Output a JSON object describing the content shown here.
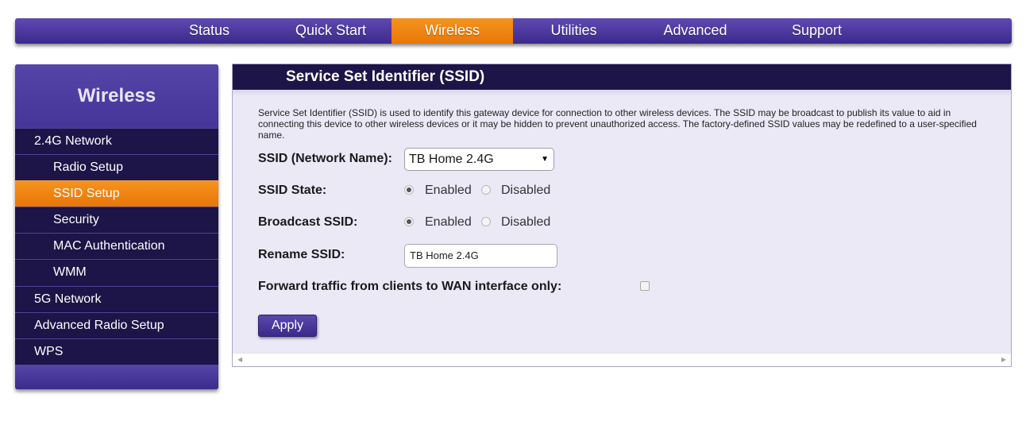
{
  "topnav": {
    "items": [
      {
        "label": "Status"
      },
      {
        "label": "Quick Start"
      },
      {
        "label": "Wireless"
      },
      {
        "label": "Utilities"
      },
      {
        "label": "Advanced"
      },
      {
        "label": "Support"
      }
    ],
    "active": "Wireless",
    "accent_color": "#ef8510",
    "brand_color": "#4a389e"
  },
  "sidebar": {
    "title": "Wireless",
    "items": [
      {
        "label": "2.4G Network"
      },
      {
        "label": "Radio Setup"
      },
      {
        "label": "SSID Setup"
      },
      {
        "label": "Security"
      },
      {
        "label": "MAC Authentication"
      },
      {
        "label": "WMM"
      },
      {
        "label": "5G Network"
      },
      {
        "label": "Advanced Radio Setup"
      },
      {
        "label": "WPS"
      }
    ],
    "active": "SSID Setup"
  },
  "main": {
    "title": "Service Set Identifier (SSID)",
    "description": "Service Set Identifier (SSID) is used to identify this gateway device for connection to other wireless devices. The SSID may be broadcast to publish its value to aid in connecting this device to other wireless devices or it may be hidden to prevent unauthorized access. The factory-defined SSID values may be redefined to a user-specified name.",
    "ssid_label": "SSID (Network Name):",
    "ssid_value": "TB Home 2.4G",
    "ssid_state_label": "SSID State:",
    "ssid_state": {
      "enabled_label": "Enabled",
      "disabled_label": "Disabled",
      "selected": "Enabled"
    },
    "broadcast_label": "Broadcast SSID:",
    "broadcast": {
      "enabled_label": "Enabled",
      "disabled_label": "Disabled",
      "selected": "Enabled"
    },
    "rename_label": "Rename SSID:",
    "rename_value": "TB Home 2.4G",
    "forward_label": "Forward traffic from clients to WAN interface only:",
    "forward_checked": false,
    "apply_label": "Apply"
  }
}
